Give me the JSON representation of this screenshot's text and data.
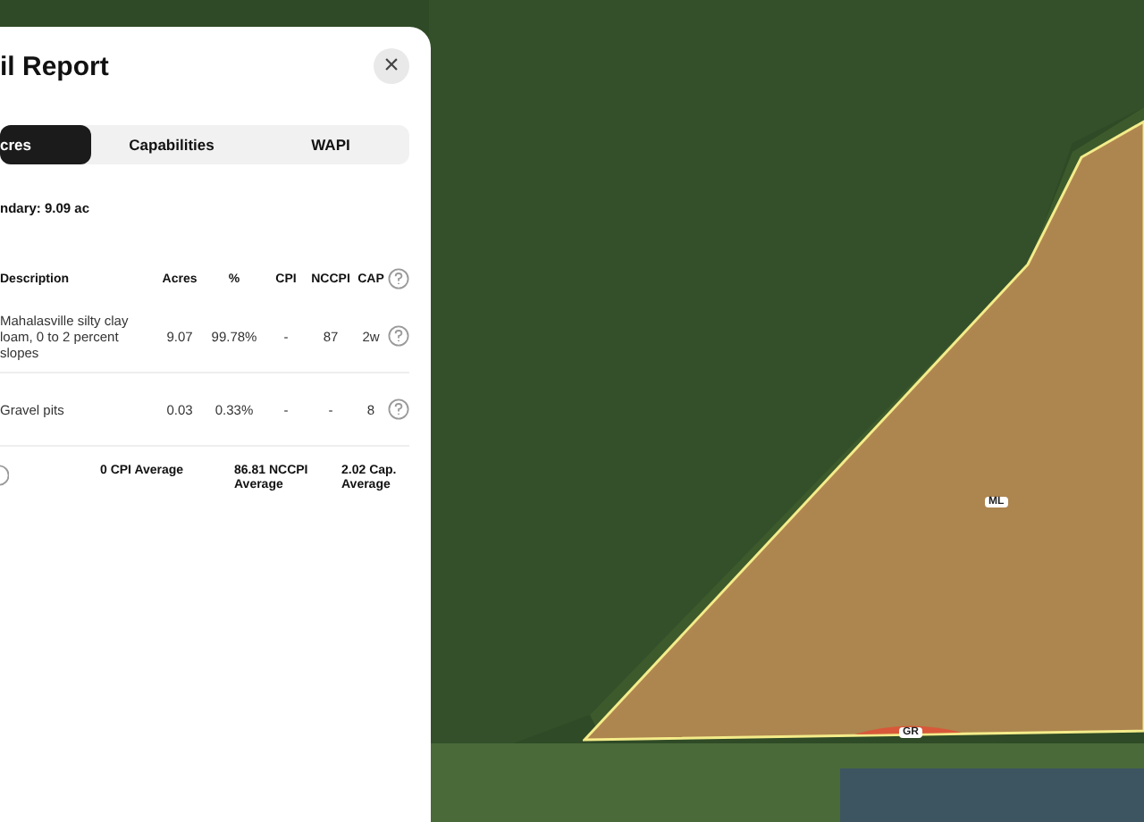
{
  "report": {
    "title": "il Report",
    "close": "×",
    "tabs": [
      {
        "label": "cres",
        "selected": true
      },
      {
        "label": "Capabilities",
        "selected": false
      },
      {
        "label": "WAPI",
        "selected": false
      }
    ],
    "boundary": "ndary: 9.09 ac",
    "table": {
      "columns": [
        "Description",
        "Acres",
        "%",
        "CPI",
        "NCCPI",
        "CAP"
      ],
      "rows": [
        {
          "cells": [
            "Mahalasville silty clay loam, 0 to 2 percent slopes",
            "9.07",
            "99.78%",
            "-",
            "87",
            "2w"
          ]
        },
        {
          "cells": [
            "Gravel pits",
            "0.03",
            "0.33%",
            "-",
            "-",
            "8"
          ]
        }
      ]
    },
    "averages": [
      "0 CPI Average",
      "86.81 NCCPI Average",
      "2.02 Cap. Average"
    ]
  },
  "map": {
    "labels": [
      {
        "text": "ML"
      },
      {
        "text": "GR"
      }
    ]
  }
}
